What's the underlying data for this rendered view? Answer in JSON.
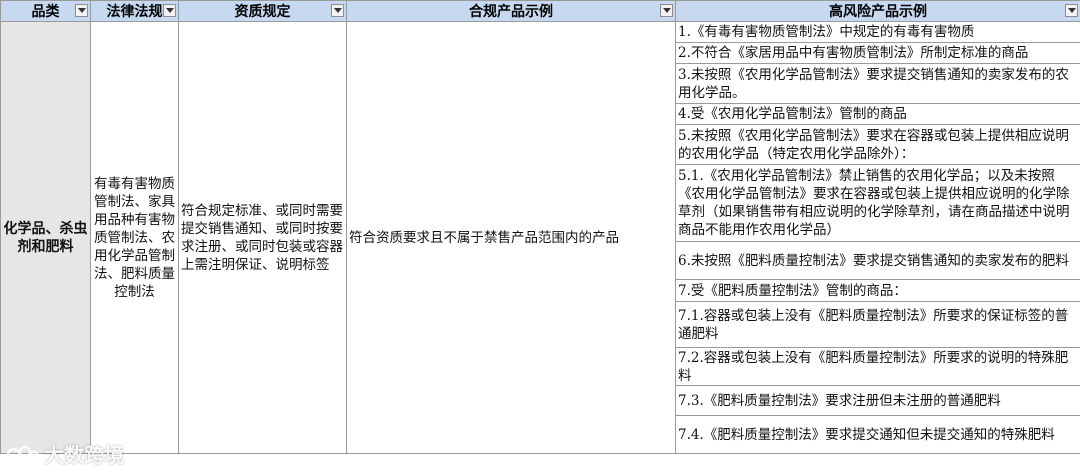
{
  "headers": {
    "category": "品类",
    "laws": "法律法规",
    "qualification": "资质规定",
    "compliant": "合规产品示例",
    "high_risk": "高风险产品示例"
  },
  "row": {
    "category": "化学品、杀虫剂和肥料",
    "laws": "有毒有害物质管制法、家具用品种有害物质管制法、农用化学品管制法、肥料质量控制法",
    "qualification": "符合规定标准、或同时需要提交销售通知、或同时按要求注册、或同时包装或容器上需注明保证、说明标签",
    "compliant": "符合资质要求且不属于禁售产品范围内的产品",
    "high_risk": [
      "1.《有毒有害物质管制法》中规定的有毒有害物质",
      "2.不符合《家居用品中有害物质管制法》所制定标准的商品",
      "3.未按照《农用化学品管制法》要求提交销售通知的卖家发布的农用化学品。",
      "4.受《农用化学品管制法》管制的商品",
      "5.未按照《农用化学品管制法》要求在容器或包装上提供相应说明的农用化学品（特定农用化学品除外）：",
      "5.1.《农用化学品管制法》禁止销售的农用化学品；以及未按照《农用化学品管制法》要求在容器或包装上提供相应说明的化学除草剂（如果销售带有相应说明的化学除草剂，请在商品描述中说明商品不能用作农用化学品）",
      "6.未按照《肥料质量控制法》要求提交销售通知的卖家发布的肥料",
      "7.受《肥料质量控制法》管制的商品：",
      "7.1.容器或包装上没有《肥料质量控制法》所要求的保证标签的普通肥料",
      "7.2.容器或包装上没有《肥料质量控制法》所要求的说明的特殊肥料",
      "7.3.《肥料质量控制法》要求注册但未注册的普通肥料",
      "7.4.《肥料质量控制法》要求提交通知但未提交通知的特殊肥料"
    ]
  },
  "watermark": "大数跨境",
  "colors": {
    "header_bg": "#c6d9f1",
    "category_bg": "#e6e6e6",
    "border": "#9a9a9a"
  }
}
